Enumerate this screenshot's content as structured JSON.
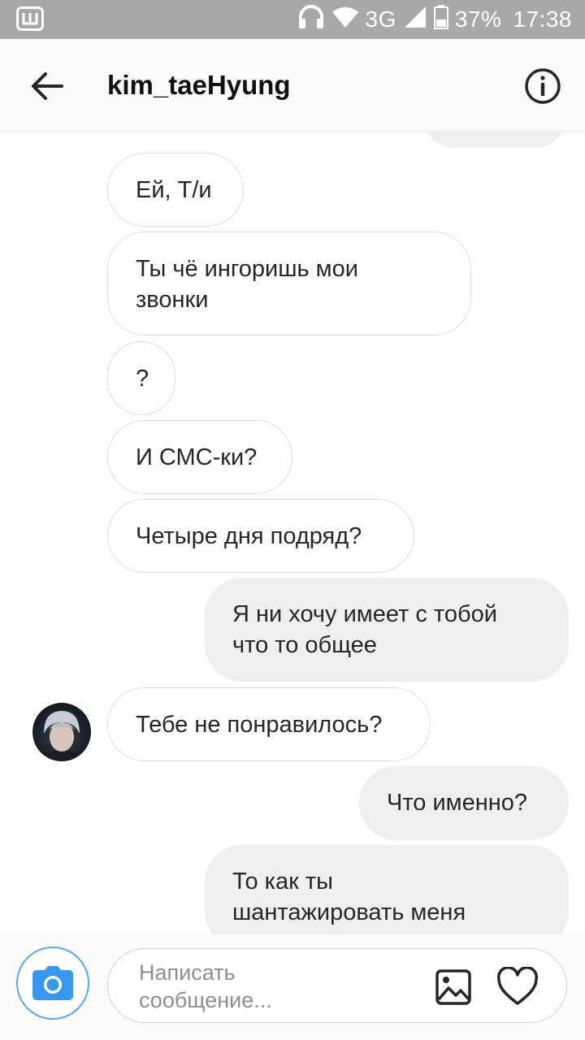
{
  "status_bar": {
    "app_icon_label": "Ш",
    "network": "3G",
    "battery": "37%",
    "time": "17:38"
  },
  "header": {
    "title": "kim_taeHyung"
  },
  "messages": [
    {
      "dir": "in",
      "text": "Ей, Т/и"
    },
    {
      "dir": "in",
      "text": "Ты чё ингоришь мои\nзвонки"
    },
    {
      "dir": "in",
      "text": "?"
    },
    {
      "dir": "in",
      "text": "И СМС-ки?"
    },
    {
      "dir": "in",
      "text": "Четыре дня подряд?"
    },
    {
      "dir": "out",
      "text": "Я ни хочу имеет с тобой\nчто то общее"
    },
    {
      "dir": "in",
      "text": "Тебе не понравилось?"
    },
    {
      "dir": "out",
      "text": "Что именно?"
    },
    {
      "dir": "out",
      "text": "То как ты\nшантажировать меня"
    }
  ],
  "composer": {
    "placeholder": "Написать\nсообщение..."
  },
  "colors": {
    "status_bar": "#a8a8a8",
    "outgoing_bubble": "#efefef",
    "incoming_border": "#dbdbdb",
    "camera_accent": "#3897f0"
  },
  "icons": [
    "back-arrow-icon",
    "info-icon",
    "camera-icon",
    "gallery-icon",
    "heart-icon",
    "headphones-icon",
    "wifi-icon",
    "signal-icon",
    "battery-icon"
  ]
}
